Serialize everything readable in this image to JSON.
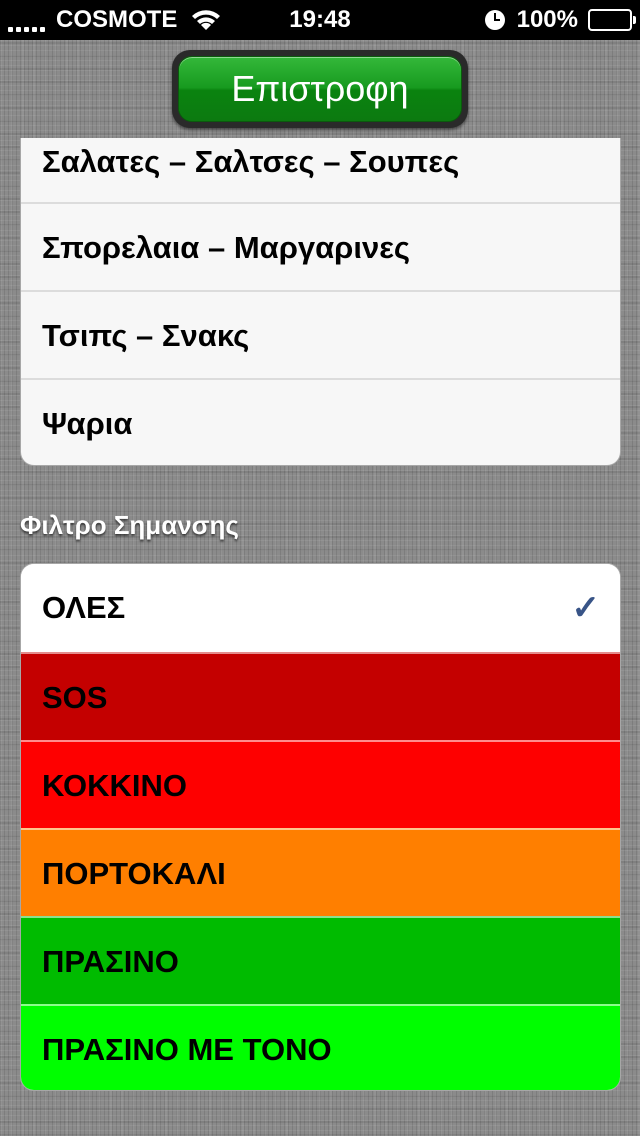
{
  "status_bar": {
    "carrier": "COSMOTE",
    "time": "19:48",
    "battery": "100%",
    "battery_level": 1.0
  },
  "nav": {
    "back_label": "Επιστροφη"
  },
  "categories": [
    {
      "label": "Σαλατες – Σαλτσες – Σουπες"
    },
    {
      "label": "Σπορελαια – Μαργαρινες"
    },
    {
      "label": "Τσιπς – Σνακς"
    },
    {
      "label": "Ψαρια"
    }
  ],
  "filter_section": {
    "title": "Φιλτρο Σημανσης",
    "options": [
      {
        "label": "ΟΛΕΣ",
        "color": "#ffffff",
        "selected": true
      },
      {
        "label": "SOS",
        "color": "#c40000",
        "selected": false
      },
      {
        "label": "ΚΟΚΚΙΝΟ",
        "color": "#fe0000",
        "selected": false
      },
      {
        "label": "ΠΟΡΤΟΚΑΛΙ",
        "color": "#ff7f00",
        "selected": false
      },
      {
        "label": "ΠΡΑΣΙΝΟ",
        "color": "#00bb00",
        "selected": false
      },
      {
        "label": "ΠΡΑΣΙΝΟ ΜΕ ΤΟΝΟ",
        "color": "#00fe00",
        "selected": false
      }
    ],
    "checkmark": "✓"
  },
  "icons": {
    "signal": "signal-bars-icon",
    "wifi": "wifi-icon",
    "alarm": "clock-icon",
    "battery": "battery-icon",
    "selected": "checkmark-icon"
  },
  "colors": {
    "back_button": "#179a1f",
    "checkmark": "#385487"
  }
}
